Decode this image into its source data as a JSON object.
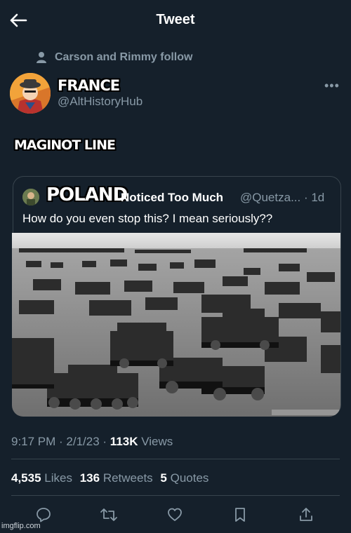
{
  "header": {
    "title": "Tweet"
  },
  "social_context": "Carson and Rimmy follow",
  "author": {
    "handle": "@AltHistoryHub"
  },
  "meme_captions": {
    "france": "FRANCE",
    "maginot": "MAGINOT LINE",
    "poland": "POLAND"
  },
  "quoted_tweet": {
    "name": "Noticed Too Much",
    "handle": "@Quetza... · 1d",
    "text": "How do you even stop this? I mean seriously??"
  },
  "meta": {
    "time": "9:17 PM · 2/1/23 · ",
    "views_count": "113K",
    "views_label": " Views"
  },
  "stats": {
    "likes_count": "4,535",
    "likes_label": "Likes",
    "retweets_count": "136",
    "retweets_label": "Retweets",
    "quotes_count": "5",
    "quotes_label": "Quotes"
  },
  "watermark": "imgflip.com",
  "colors": {
    "background": "#15202b",
    "text_secondary": "#8899a6",
    "border": "#38444d"
  }
}
